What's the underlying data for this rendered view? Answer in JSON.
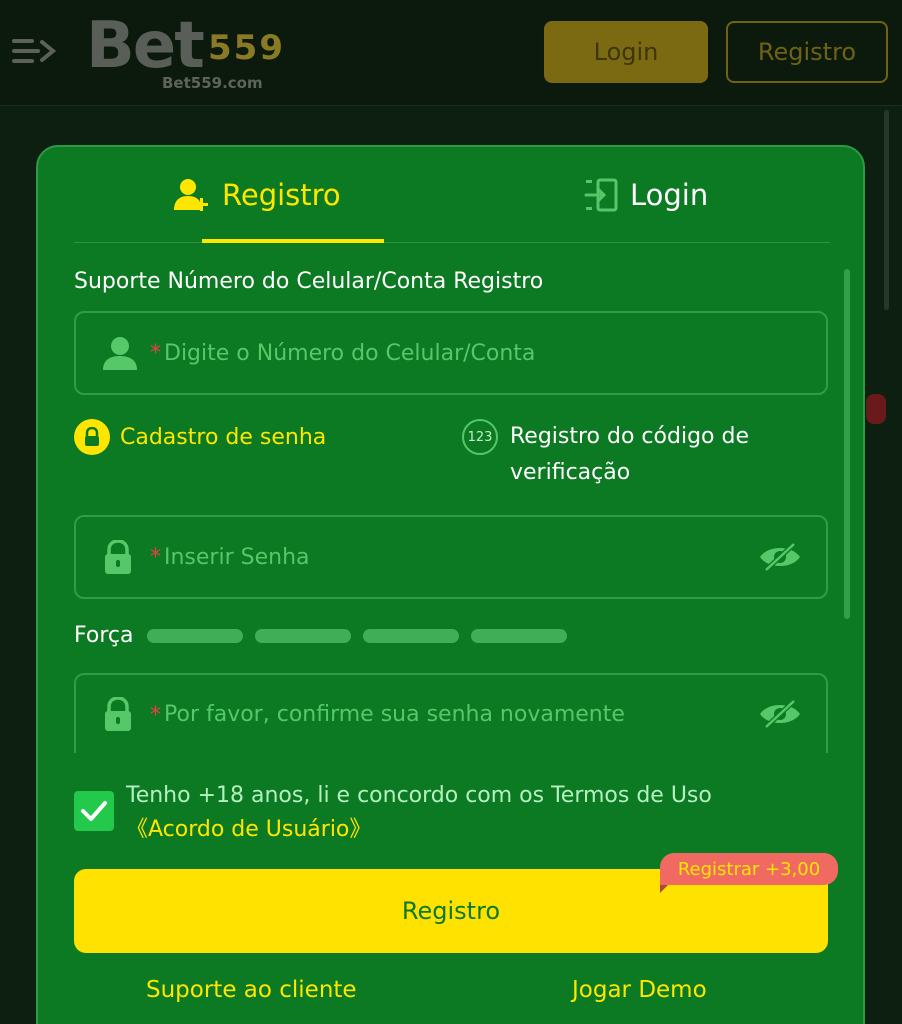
{
  "header": {
    "logo_text": "Bet",
    "logo_digits": "559",
    "logo_domain": "Bet559.com",
    "login_label": "Login",
    "register_label": "Registro"
  },
  "modal": {
    "tabs": [
      {
        "label": "Registro",
        "icon": "user-add-icon",
        "active": true
      },
      {
        "label": "Login",
        "icon": "login-door-icon",
        "active": false
      }
    ],
    "section_label": "Suporte Número do Celular/Conta Registro",
    "account_field": {
      "required_mark": "*",
      "placeholder": "Digite o Número do Celular/Conta"
    },
    "modes": {
      "password_label": "Cadastro de senha",
      "code_badge": "123",
      "code_label": "Registro do código de verificação"
    },
    "password_field": {
      "required_mark": "*",
      "placeholder": "Inserir Senha"
    },
    "strength": {
      "label": "Força",
      "level": 0,
      "segments": 4
    },
    "confirm_field": {
      "required_mark": "*",
      "placeholder": "Por favor, confirme sua senha novamente"
    },
    "terms": {
      "checked": true,
      "text": "Tenho +18 anos, li e concordo com os Termos de Uso",
      "link": "《Acordo de Usuário》"
    },
    "register_button": "Registro",
    "bonus_badge": "Registrar +3,00",
    "support_link": "Suporte ao cliente",
    "demo_link": "Jogar Demo"
  },
  "colors": {
    "modal_bg": "#0b7a22",
    "accent_yellow": "#ffe600",
    "placeholder_green": "#56c86a",
    "badge_red": "#f06a62"
  }
}
